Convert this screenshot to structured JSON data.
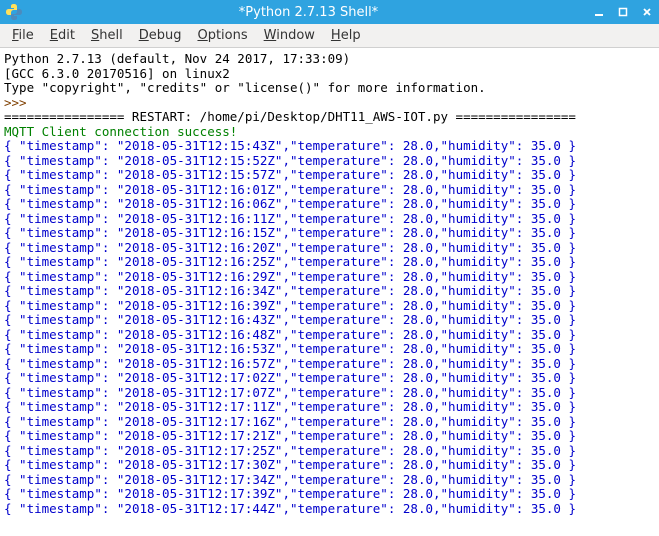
{
  "window": {
    "title": "*Python 2.7.13 Shell*"
  },
  "menu": {
    "file": {
      "u": "F",
      "rest": "ile"
    },
    "edit": {
      "u": "E",
      "rest": "dit"
    },
    "shell": {
      "u": "S",
      "rest": "hell"
    },
    "debug": {
      "u": "D",
      "rest": "ebug"
    },
    "options": {
      "u": "O",
      "rest": "ptions"
    },
    "window": {
      "u": "W",
      "rest": "indow"
    },
    "help": {
      "u": "H",
      "rest": "elp"
    }
  },
  "console": {
    "banner": [
      "Python 2.7.13 (default, Nov 24 2017, 17:33:09)",
      "[GCC 6.3.0 20170516] on linux2",
      "Type \"copyright\", \"credits\" or \"license()\" for more information."
    ],
    "prompt": ">>> ",
    "restart_label": "================ RESTART: ",
    "restart_path": "/home/pi/Desktop/DHT11_AWS-IOT.py",
    "restart_tail": " ================",
    "mqtt_line": "MQTT Client connection success!",
    "reading_open": "{",
    "reading_close": "}",
    "ts_key": " \"timestamp\": ",
    "temp_key": ",\"temperature\": ",
    "hum_key": ",\"humidity\": ",
    "readings": [
      {
        "timestamp": "2018-05-31T12:15:43Z",
        "temperature": 28.0,
        "humidity": 35.0
      },
      {
        "timestamp": "2018-05-31T12:15:52Z",
        "temperature": 28.0,
        "humidity": 35.0
      },
      {
        "timestamp": "2018-05-31T12:15:57Z",
        "temperature": 28.0,
        "humidity": 35.0
      },
      {
        "timestamp": "2018-05-31T12:16:01Z",
        "temperature": 28.0,
        "humidity": 35.0
      },
      {
        "timestamp": "2018-05-31T12:16:06Z",
        "temperature": 28.0,
        "humidity": 35.0
      },
      {
        "timestamp": "2018-05-31T12:16:11Z",
        "temperature": 28.0,
        "humidity": 35.0
      },
      {
        "timestamp": "2018-05-31T12:16:15Z",
        "temperature": 28.0,
        "humidity": 35.0
      },
      {
        "timestamp": "2018-05-31T12:16:20Z",
        "temperature": 28.0,
        "humidity": 35.0
      },
      {
        "timestamp": "2018-05-31T12:16:25Z",
        "temperature": 28.0,
        "humidity": 35.0
      },
      {
        "timestamp": "2018-05-31T12:16:29Z",
        "temperature": 28.0,
        "humidity": 35.0
      },
      {
        "timestamp": "2018-05-31T12:16:34Z",
        "temperature": 28.0,
        "humidity": 35.0
      },
      {
        "timestamp": "2018-05-31T12:16:39Z",
        "temperature": 28.0,
        "humidity": 35.0
      },
      {
        "timestamp": "2018-05-31T12:16:43Z",
        "temperature": 28.0,
        "humidity": 35.0
      },
      {
        "timestamp": "2018-05-31T12:16:48Z",
        "temperature": 28.0,
        "humidity": 35.0
      },
      {
        "timestamp": "2018-05-31T12:16:53Z",
        "temperature": 28.0,
        "humidity": 35.0
      },
      {
        "timestamp": "2018-05-31T12:16:57Z",
        "temperature": 28.0,
        "humidity": 35.0
      },
      {
        "timestamp": "2018-05-31T12:17:02Z",
        "temperature": 28.0,
        "humidity": 35.0
      },
      {
        "timestamp": "2018-05-31T12:17:07Z",
        "temperature": 28.0,
        "humidity": 35.0
      },
      {
        "timestamp": "2018-05-31T12:17:11Z",
        "temperature": 28.0,
        "humidity": 35.0
      },
      {
        "timestamp": "2018-05-31T12:17:16Z",
        "temperature": 28.0,
        "humidity": 35.0
      },
      {
        "timestamp": "2018-05-31T12:17:21Z",
        "temperature": 28.0,
        "humidity": 35.0
      },
      {
        "timestamp": "2018-05-31T12:17:25Z",
        "temperature": 28.0,
        "humidity": 35.0
      },
      {
        "timestamp": "2018-05-31T12:17:30Z",
        "temperature": 28.0,
        "humidity": 35.0
      },
      {
        "timestamp": "2018-05-31T12:17:34Z",
        "temperature": 28.0,
        "humidity": 35.0
      },
      {
        "timestamp": "2018-05-31T12:17:39Z",
        "temperature": 28.0,
        "humidity": 35.0
      },
      {
        "timestamp": "2018-05-31T12:17:44Z",
        "temperature": 28.0,
        "humidity": 35.0
      }
    ]
  }
}
